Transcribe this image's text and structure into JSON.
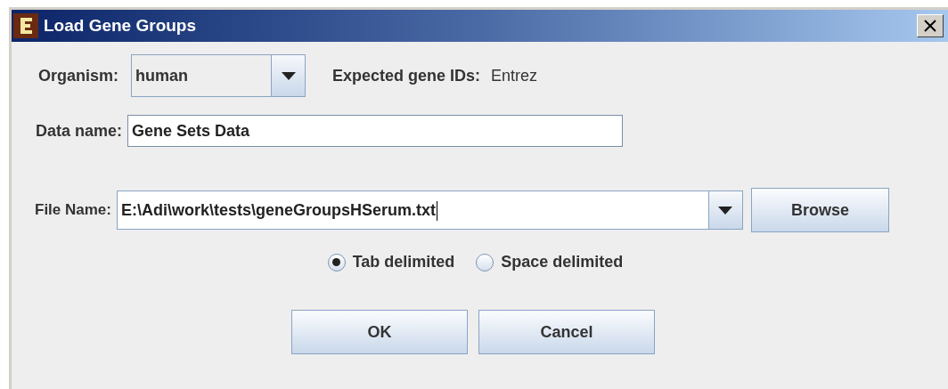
{
  "window": {
    "title": "Load Gene Groups"
  },
  "organism": {
    "label": "Organism:",
    "value": "human"
  },
  "expected_ids": {
    "label": "Expected gene IDs:",
    "value": "Entrez"
  },
  "data_name": {
    "label": "Data name:",
    "value": "Gene Sets Data"
  },
  "file_name": {
    "label": "File Name:",
    "value": "E:\\Adi\\work\\tests\\geneGroupsHSerum.txt"
  },
  "browse_button": "Browse",
  "delimiters": [
    {
      "label": "Tab delimited",
      "selected": true
    },
    {
      "label": "Space delimited",
      "selected": false
    }
  ],
  "buttons": [
    {
      "label": "OK"
    },
    {
      "label": "Cancel"
    }
  ]
}
